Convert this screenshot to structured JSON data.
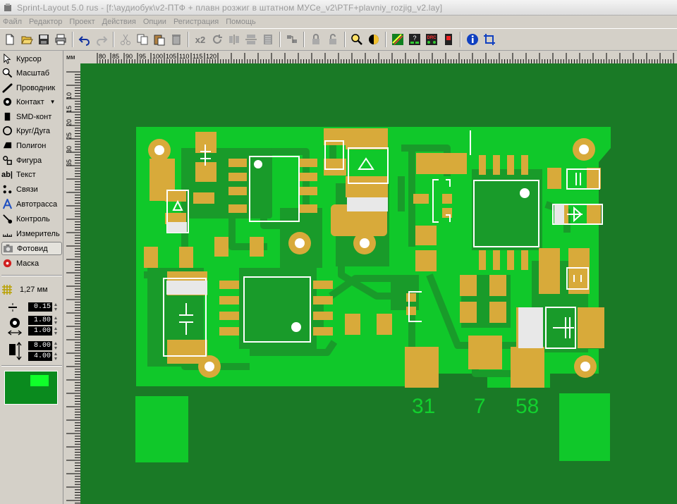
{
  "window": {
    "title": "Sprint-Layout 5.0 rus     - [f:\\аудиобук\\v2-ПТФ + плавн розжиг в штатном МУСе_v2\\PTF+plavniy_rozjig_v2.lay]"
  },
  "menu": [
    "Файл",
    "Редактор",
    "Проект",
    "Действия",
    "Опции",
    "Регистрация",
    "Помощь"
  ],
  "toolbar": {
    "zoom_label": "x2",
    "icons": [
      "new-icon",
      "open-icon",
      "save-icon",
      "print-icon",
      "undo-icon",
      "redo-icon",
      "cut-icon",
      "copy-icon",
      "paste-icon",
      "delete-icon",
      "zoom-x2-icon",
      "rotate-icon",
      "mirror-h-icon",
      "mirror-v-icon",
      "align-icon",
      "group-icon",
      "lock-icon",
      "unlock-icon",
      "magnifier-icon",
      "color-icon",
      "autoroute-icon",
      "test-icon",
      "drc-icon",
      "info-icon",
      "crop-icon"
    ]
  },
  "tools": [
    {
      "label": "Курсор",
      "icon": "cursor-icon"
    },
    {
      "label": "Масштаб",
      "icon": "zoom-icon"
    },
    {
      "label": "Проводник",
      "icon": "track-icon"
    },
    {
      "label": "Контакт",
      "icon": "pad-icon"
    },
    {
      "label": "SMD-конт",
      "icon": "smd-pad-icon"
    },
    {
      "label": "Круг/Дуга",
      "icon": "circle-icon"
    },
    {
      "label": "Полигон",
      "icon": "polygon-icon"
    },
    {
      "label": "Фигура",
      "icon": "shape-icon"
    },
    {
      "label": "Текст",
      "icon": "text-icon"
    },
    {
      "label": "Связи",
      "icon": "connections-icon"
    },
    {
      "label": "Автотрасса",
      "icon": "autoroute-tool-icon"
    },
    {
      "label": "Контроль",
      "icon": "test-tool-icon"
    },
    {
      "label": "Измеритель",
      "icon": "measure-icon"
    },
    {
      "label": "Фотовид",
      "icon": "photoview-icon"
    },
    {
      "label": "Маска",
      "icon": "mask-icon"
    }
  ],
  "grid": {
    "label": "1,27 мм"
  },
  "params": {
    "track_width": "0.15",
    "pad_outer": "1.80",
    "pad_inner": "1.00",
    "smd_w": "8.00",
    "smd_h": "4.00"
  },
  "ruler": {
    "unit": "мм",
    "top_labels": [
      "80",
      "85",
      "90",
      "95",
      "100",
      "105",
      "110",
      "115",
      "120"
    ],
    "left_labels": [
      "10",
      "15",
      "20",
      "25",
      "30",
      "35"
    ]
  },
  "board": {
    "labels": [
      "31",
      "7",
      "58"
    ]
  },
  "colors": {
    "canvas_bg": "#1a7a26",
    "board_green": "#10c82a",
    "copper_dark": "#199b2a",
    "pad_gold": "#d8aa3a",
    "silk_white": "#ffffff"
  }
}
